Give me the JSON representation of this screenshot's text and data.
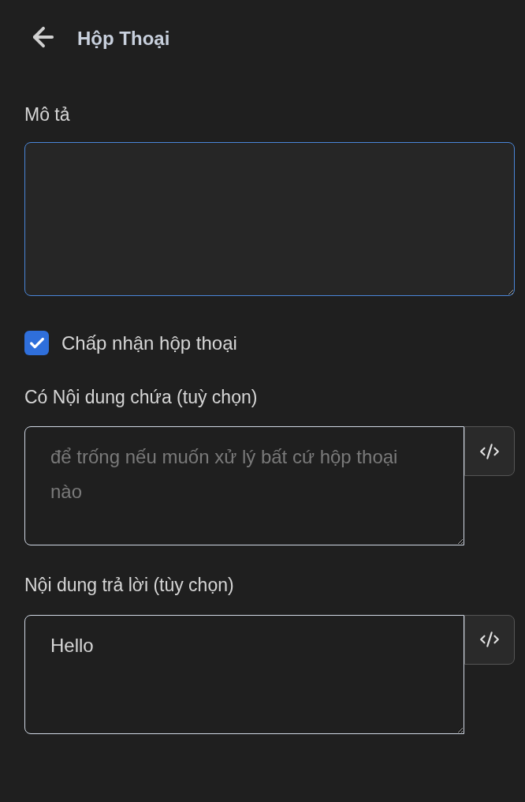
{
  "header": {
    "title": "Hộp Thoại"
  },
  "description": {
    "label": "Mô tả",
    "focused": true
  },
  "accept_dialog": {
    "label": "Chấp nhận hộp thoại",
    "checked": true
  },
  "fields": [
    {
      "label": "Có Nội dung chứa (tuỳ chọn)",
      "placeholder": "để trống nếu muốn xử lý bất cứ hộp thoại nào"
    },
    {
      "label": "Nội dung trả lời (tùy chọn)",
      "value": "Hello"
    }
  ]
}
